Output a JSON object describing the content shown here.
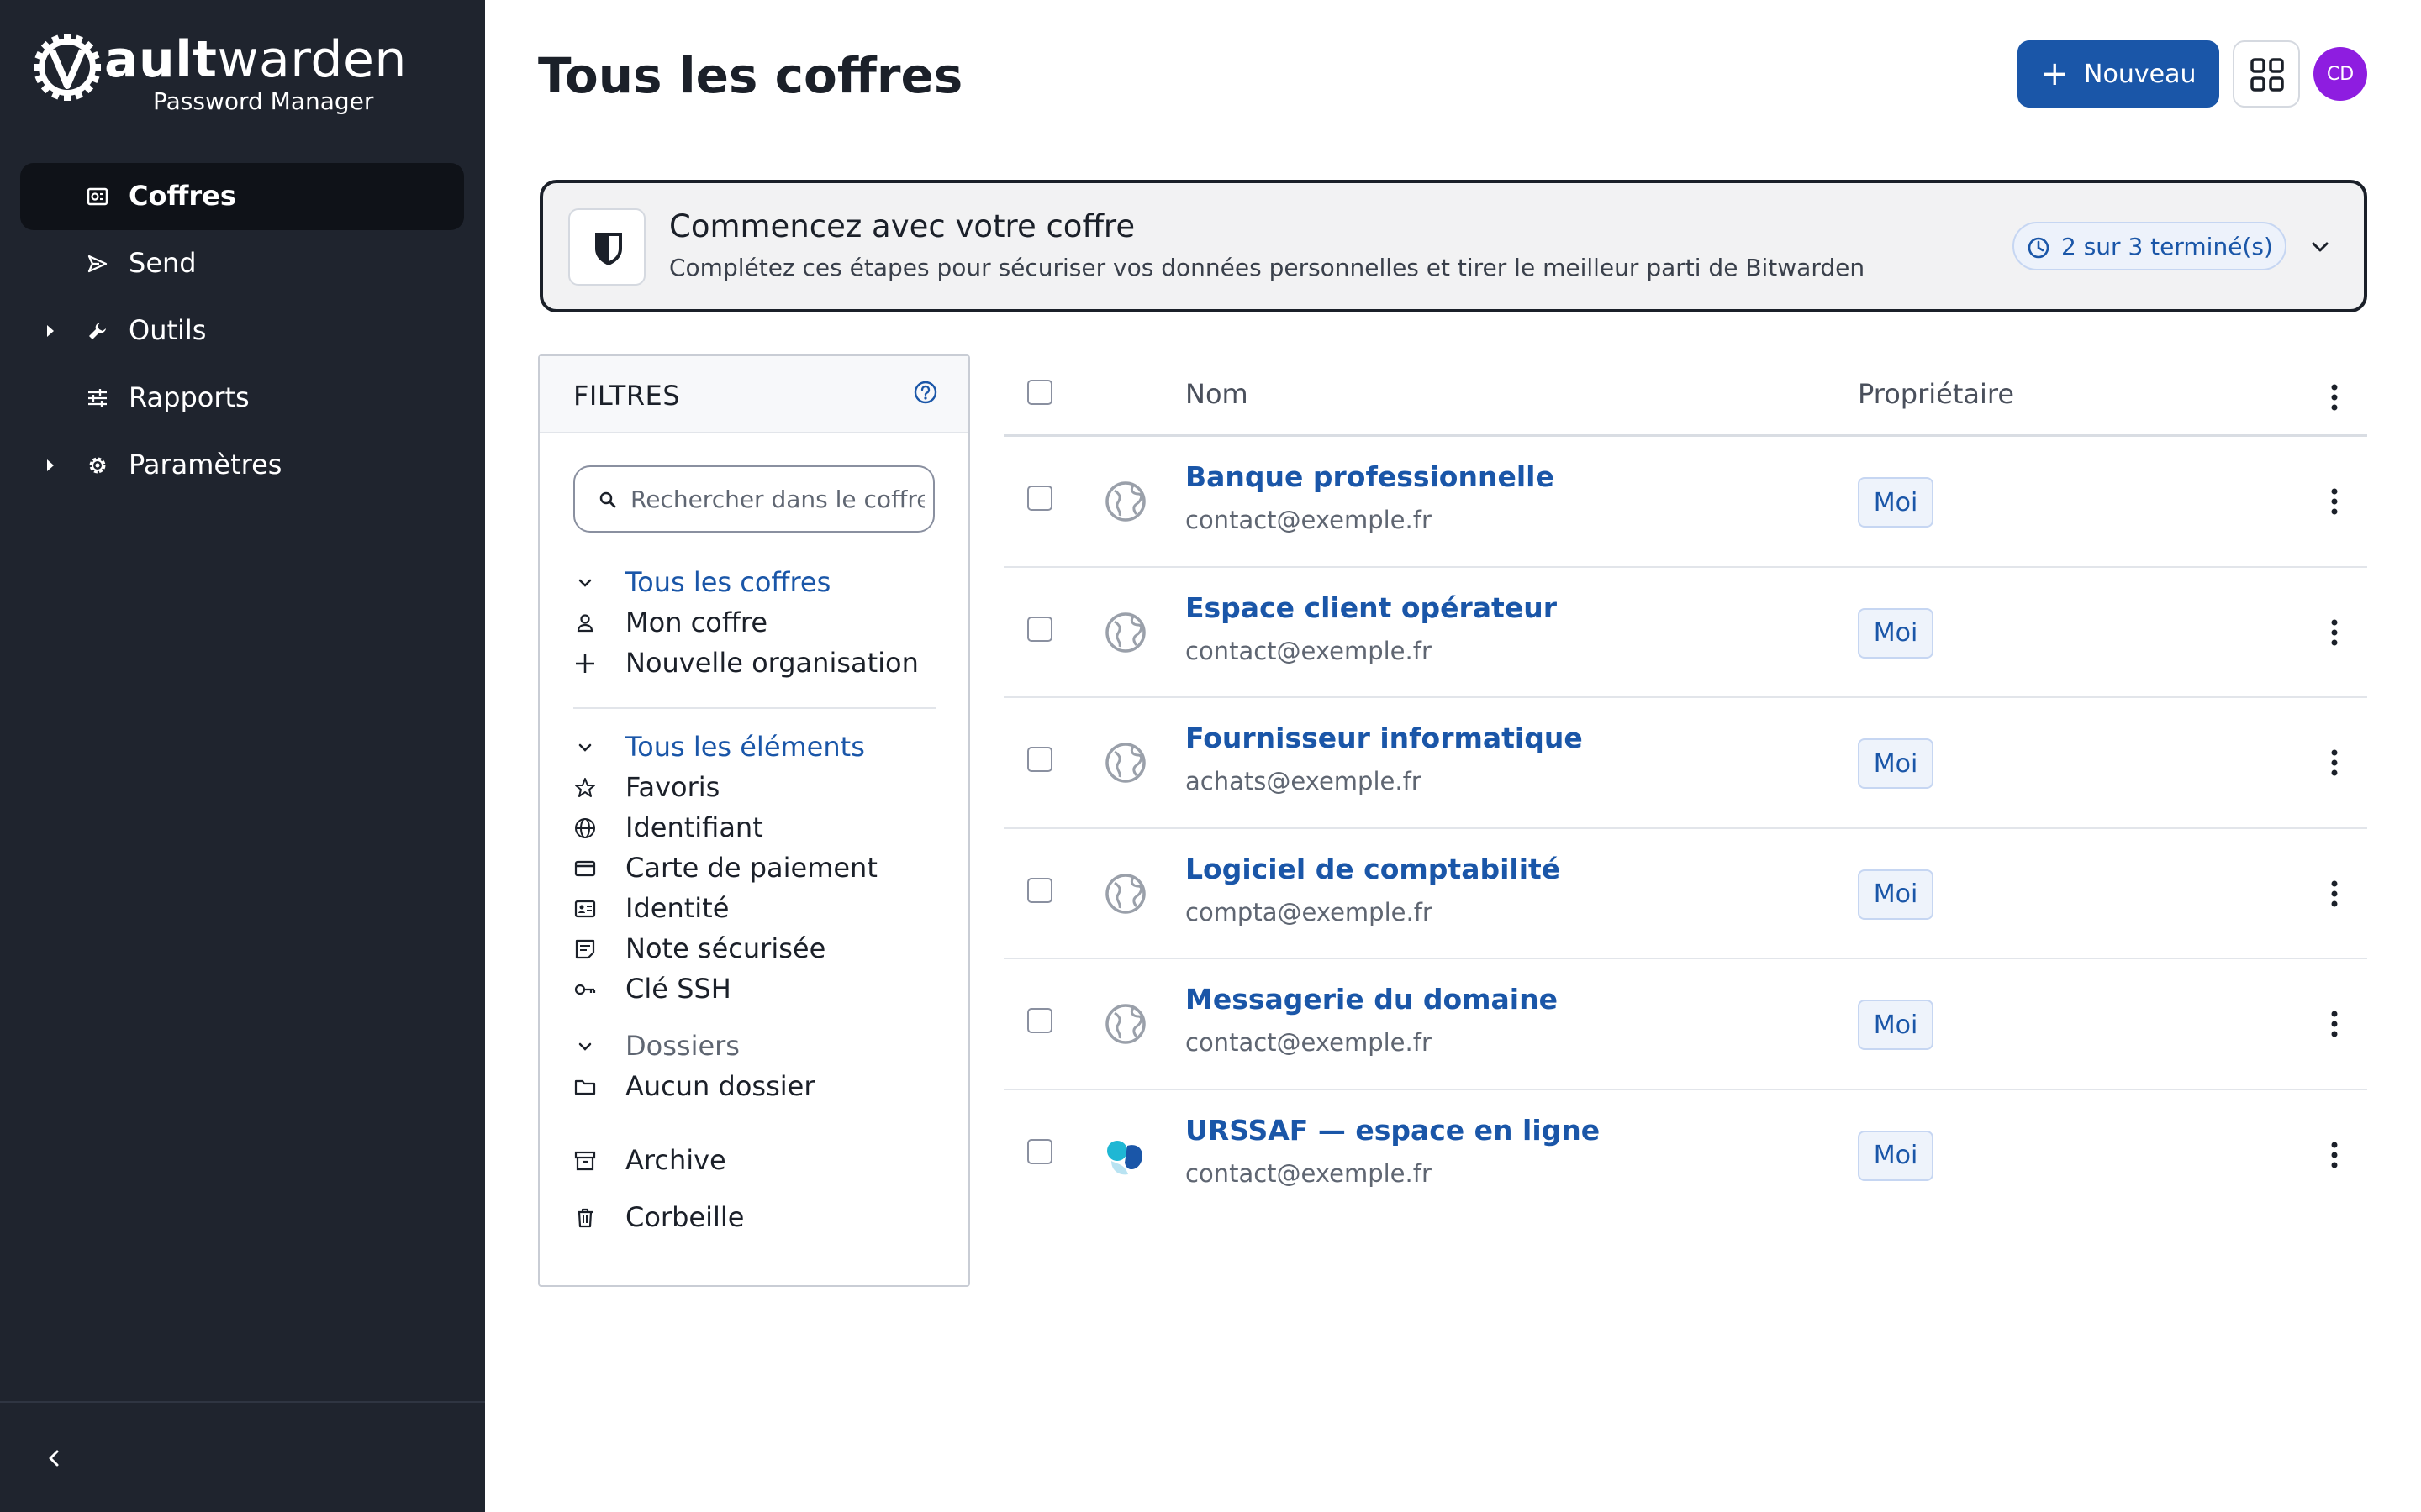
{
  "brand": {
    "name_bold": "ault",
    "name_rest": "warden",
    "subtitle": "Password Manager"
  },
  "sidebar": {
    "items": [
      {
        "label": "Coffres",
        "icon": "vault-icon",
        "active": true,
        "expandable": false
      },
      {
        "label": "Send",
        "icon": "send-icon",
        "active": false,
        "expandable": false
      },
      {
        "label": "Outils",
        "icon": "wrench-icon",
        "active": false,
        "expandable": true
      },
      {
        "label": "Rapports",
        "icon": "sliders-icon",
        "active": false,
        "expandable": false
      },
      {
        "label": "Paramètres",
        "icon": "gear-icon",
        "active": false,
        "expandable": true
      }
    ]
  },
  "header": {
    "title": "Tous les coffres",
    "new_button": "Nouveau",
    "avatar_initials": "CD",
    "avatar_color": "#8e1de0",
    "accent_color": "#1a56a8"
  },
  "banner": {
    "title": "Commencez avec votre coffre",
    "description": "Complétez ces étapes pour sécuriser vos données personnelles et tirer le meilleur parti de Bitwarden",
    "progress": "2 sur 3 terminé(s)"
  },
  "filters": {
    "title": "FILTRES",
    "search_placeholder": "Rechercher dans le coffre",
    "vaults_group": "Tous les coffres",
    "my_vault": "Mon coffre",
    "new_org": "Nouvelle organisation",
    "types_group": "Tous les éléments",
    "types": [
      "Favoris",
      "Identifiant",
      "Carte de paiement",
      "Identité",
      "Note sécurisée",
      "Clé SSH"
    ],
    "folders_group": "Dossiers",
    "no_folder": "Aucun dossier",
    "archive": "Archive",
    "trash": "Corbeille"
  },
  "table": {
    "col_name": "Nom",
    "col_owner": "Propriétaire",
    "rows": [
      {
        "name": "Banque professionnelle",
        "sub": "contact@exemple.fr",
        "owner": "Moi",
        "icon": "globe-icon"
      },
      {
        "name": "Espace client opérateur",
        "sub": "contact@exemple.fr",
        "owner": "Moi",
        "icon": "globe-icon"
      },
      {
        "name": "Fournisseur informatique",
        "sub": "achats@exemple.fr",
        "owner": "Moi",
        "icon": "globe-icon"
      },
      {
        "name": "Logiciel de comptabilité",
        "sub": "compta@exemple.fr",
        "owner": "Moi",
        "icon": "globe-icon"
      },
      {
        "name": "Messagerie du domaine",
        "sub": "contact@exemple.fr",
        "owner": "Moi",
        "icon": "globe-icon"
      },
      {
        "name": "URSSAF — espace en ligne",
        "sub": "contact@exemple.fr",
        "owner": "Moi",
        "icon": "urssaf-logo-icon"
      }
    ]
  }
}
